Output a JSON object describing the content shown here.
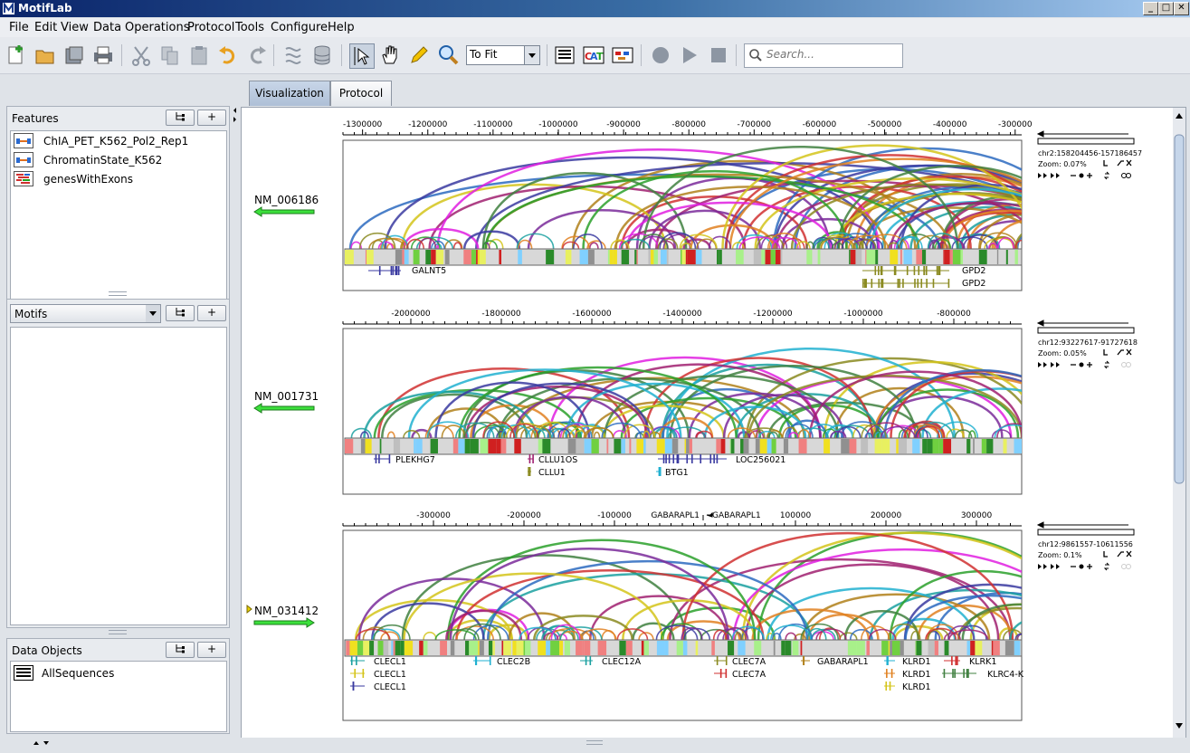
{
  "app": {
    "title": "MotifLab"
  },
  "menu": [
    "File",
    "Edit",
    "View",
    "Data",
    "Operations",
    "Protocol",
    "Tools",
    "Configure",
    "Help"
  ],
  "toolbar": {
    "zoom_value": "To Fit",
    "search_placeholder": "Search..."
  },
  "features_panel": {
    "title": "Features",
    "items": [
      {
        "label": "ChIA_PET_K562_Pol2_Rep1",
        "icon": "interaction-track-icon"
      },
      {
        "label": "ChromatinState_K562",
        "icon": "region-track-icon"
      },
      {
        "label": "genesWithExons",
        "icon": "gene-track-icon"
      }
    ]
  },
  "motifs_panel": {
    "selector": "Motifs"
  },
  "data_objects_panel": {
    "title": "Data Objects",
    "items": [
      {
        "label": "AllSequences",
        "icon": "collection-icon"
      }
    ]
  },
  "tabs": [
    {
      "label": "Visualization",
      "active": true
    },
    {
      "label": "Protocol",
      "active": false
    }
  ],
  "sequences": [
    {
      "name": "NM_006186",
      "orientation": "reverse",
      "location": "chr2:158204456-157186457",
      "zoom": "Zoom:   0.07%",
      "ticks": [
        "-1300000",
        "-1200000",
        "-1100000",
        "-1000000",
        "-900000",
        "-800000",
        "-700000",
        "-600000",
        "-500000",
        "-400000",
        "-300000"
      ],
      "tick_values": [
        -1300000,
        -1200000,
        -1100000,
        -1000000,
        -900000,
        -800000,
        -700000,
        -600000,
        -500000,
        -400000,
        -300000
      ],
      "axis_range": [
        -1330000,
        -290000
      ],
      "genes": [
        {
          "label": "GALNT5"
        },
        {
          "label": "GPD2"
        },
        {
          "label": "GPD2"
        }
      ]
    },
    {
      "name": "NM_001731",
      "orientation": "reverse",
      "location": "chr12:93227617-91727618",
      "zoom": "Zoom:   0.05%",
      "ticks": [
        "-2000000",
        "-1800000",
        "-1600000",
        "-1400000",
        "-1200000",
        "-1000000",
        "-800000"
      ],
      "tick_values": [
        -2000000,
        -1800000,
        -1600000,
        -1400000,
        -1200000,
        -1000000,
        -800000
      ],
      "axis_range": [
        -2150000,
        -650000
      ],
      "genes": [
        {
          "label": "PLEKHG7"
        },
        {
          "label": "CLLU1OS"
        },
        {
          "label": "CLLU1"
        },
        {
          "label": "BTG1"
        },
        {
          "label": "LOC256021"
        }
      ]
    },
    {
      "name": "NM_031412",
      "orientation": "forward",
      "location": "chr12:9861557-10611556",
      "zoom": "Zoom:   0.1%",
      "ticks": [
        "-300000",
        "-200000",
        "-100000",
        "100000",
        "200000",
        "300000"
      ],
      "tick_values": [
        -300000,
        -200000,
        -100000,
        100000,
        200000,
        300000
      ],
      "axis_range": [
        -400000,
        350000
      ],
      "tss_labels": [
        "GABARAPL1",
        "GABARAPL1"
      ],
      "genes": [
        {
          "label": "CLECL1"
        },
        {
          "label": "CLECL1"
        },
        {
          "label": "CLECL1"
        },
        {
          "label": "CLEC2B"
        },
        {
          "label": "CLEC12A"
        },
        {
          "label": "CLEC7A"
        },
        {
          "label": "CLEC7A"
        },
        {
          "label": "GABARAPL1"
        },
        {
          "label": "KLRD1"
        },
        {
          "label": "KLRD1"
        },
        {
          "label": "KLRD1"
        },
        {
          "label": "KLRK1"
        },
        {
          "label": "KLRC4-K"
        }
      ]
    }
  ]
}
